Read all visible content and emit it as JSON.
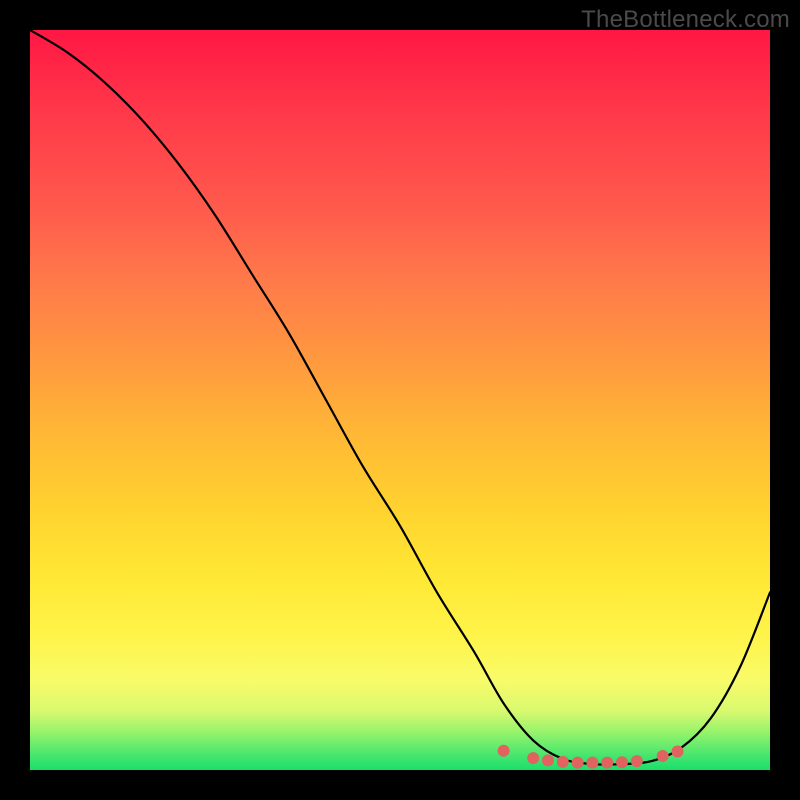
{
  "watermark": "TheBottleneck.com",
  "chart_data": {
    "type": "line",
    "title": "",
    "xlabel": "",
    "ylabel": "",
    "xlim": [
      0,
      100
    ],
    "ylim": [
      0,
      100
    ],
    "series": [
      {
        "name": "curve",
        "x": [
          0,
          5,
          10,
          15,
          20,
          25,
          30,
          35,
          40,
          45,
          50,
          55,
          60,
          64,
          68,
          72,
          76,
          80,
          84,
          88,
          92,
          96,
          100
        ],
        "values": [
          100,
          97,
          93,
          88,
          82,
          75,
          67,
          59,
          50,
          41,
          33,
          24,
          16,
          9,
          4,
          1.5,
          0.8,
          0.8,
          1.2,
          3,
          7,
          14,
          24
        ]
      }
    ],
    "markers": {
      "name": "highlight-dots",
      "color": "#e0635f",
      "x": [
        64.0,
        68.0,
        70.0,
        72.0,
        74.0,
        76.0,
        78.0,
        80.0,
        82.0,
        85.5,
        87.5
      ],
      "values": [
        2.6,
        1.6,
        1.3,
        1.1,
        1.0,
        1.0,
        1.0,
        1.05,
        1.2,
        1.9,
        2.5
      ]
    },
    "background_gradient": {
      "top": "#ff1744",
      "mid_upper": "#ff9a3f",
      "mid_lower": "#fff44a",
      "bottom": "#19df6c"
    }
  }
}
